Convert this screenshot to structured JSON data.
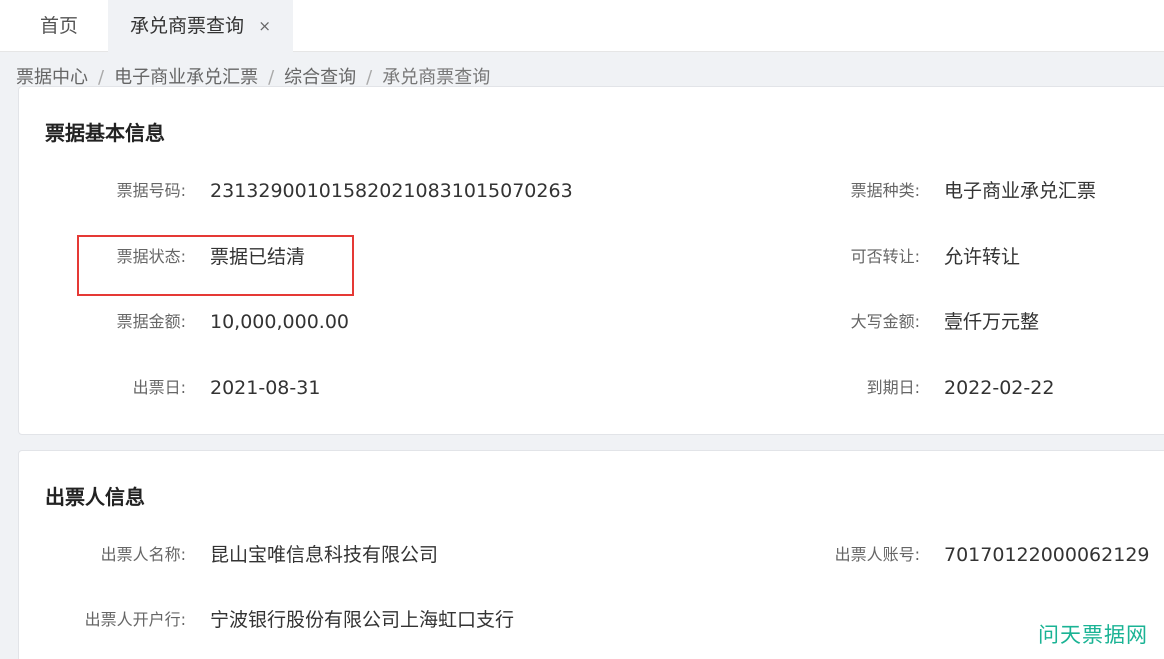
{
  "tabs": {
    "home": "首页",
    "active": "承兑商票查询",
    "close": "×"
  },
  "breadcrumb": [
    "票据中心",
    "电子商业承兑汇票",
    "综合查询",
    "承兑商票查询"
  ],
  "breadcrumb_sep": "/",
  "basic": {
    "title": "票据基本信息",
    "bill_no_label": "票据号码:",
    "bill_no": "231329001015820210831015070263",
    "bill_type_label": "票据种类:",
    "bill_type": "电子商业承兑汇票",
    "status_label": "票据状态:",
    "status": "票据已结清",
    "transferable_label": "可否转让:",
    "transferable": "允许转让",
    "amount_label": "票据金额:",
    "amount": "10,000,000.00",
    "amount_cn_label": "大写金额:",
    "amount_cn": "壹仟万元整",
    "issue_date_label": "出票日:",
    "issue_date": "2021-08-31",
    "due_date_label": "到期日:",
    "due_date": "2022-02-22"
  },
  "drawer": {
    "title": "出票人信息",
    "name_label": "出票人名称:",
    "name": "昆山宝唯信息科技有限公司",
    "account_label": "出票人账号:",
    "account": "70170122000062129",
    "bank_label": "出票人开户行:",
    "bank": "宁波银行股份有限公司上海虹口支行"
  },
  "watermark": "问天票据网",
  "colors": {
    "highlight": "#e53935",
    "watermark": "#1ab394"
  }
}
